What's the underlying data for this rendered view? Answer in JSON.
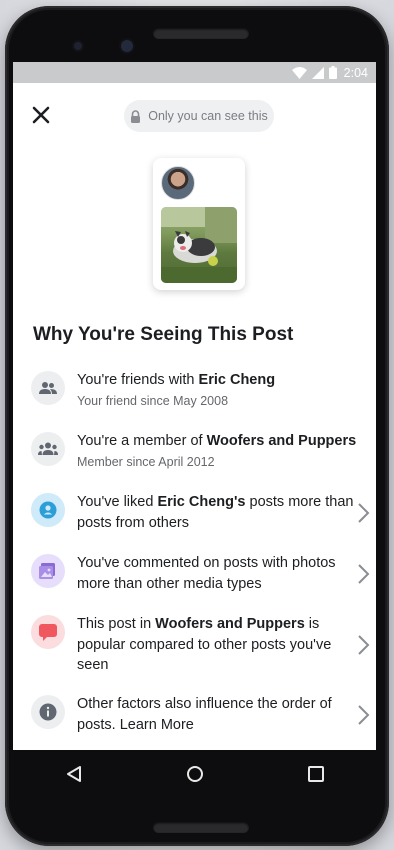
{
  "status_bar": {
    "time": "2:04"
  },
  "top_bar": {
    "privacy_label": "Only you can see this"
  },
  "title": "Why You're Seeing This Post",
  "reasons": [
    {
      "text_before": "You're friends with ",
      "bold": "Eric Cheng",
      "text_after": "",
      "sub": "Your friend since May 2008",
      "icon": "friends-icon",
      "icon_bg": "#eceef0",
      "icon_color": "#606770"
    },
    {
      "text_before": "You're a member of ",
      "bold": "Woofers and Puppers",
      "text_after": "",
      "sub": "Member since April 2012",
      "icon": "group-icon",
      "icon_bg": "#eceef0",
      "icon_color": "#606770"
    },
    {
      "text_before": "You've liked ",
      "bold": "Eric Cheng's",
      "text_after": " posts more than posts from others",
      "icon": "person-icon",
      "icon_bg": "#cfeaf8",
      "icon_color": "#2d9fd8"
    },
    {
      "text_before": "You've commented on posts with photos more than other media types",
      "bold": "",
      "text_after": "",
      "icon": "photo-icon",
      "icon_bg": "#e6defa",
      "icon_color": "#8c6ad6"
    },
    {
      "text_before": "This post in ",
      "bold": "Woofers and Puppers",
      "text_after": " is popular compared to other posts you've seen",
      "icon": "comment-icon",
      "icon_bg": "#fbdde0",
      "icon_color": "#f0575f"
    },
    {
      "text_before": "Other factors also influence the order of posts. Learn More",
      "bold": "",
      "text_after": "",
      "icon": "info-icon",
      "icon_bg": "#eceef0",
      "icon_color": "#606770"
    }
  ],
  "colors": {
    "text_primary": "#1c1e21",
    "text_secondary": "#65676b",
    "chevron": "#8a8d91"
  }
}
